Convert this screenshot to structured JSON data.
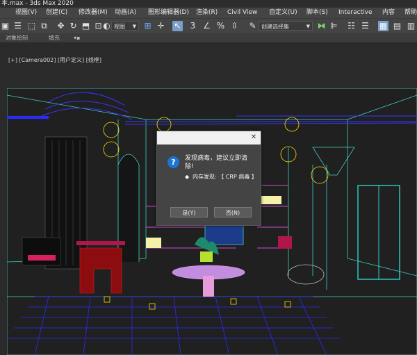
{
  "window": {
    "title": "本.max - 3ds Max 2020"
  },
  "menu": [
    "视图(V)",
    "创建(C)",
    "修改器(M)",
    "动画(A)",
    "图形编辑器(D)",
    "渲染(R)",
    "Civil View",
    "自定义(U)",
    "脚本(S)",
    "Interactive",
    "内容",
    "帮助"
  ],
  "toolbar": {
    "view_dropdown": "视图",
    "selection_set_dropdown": "创建选择集"
  },
  "ribbon": {
    "tab1": "对象绘制",
    "tab2": "填充"
  },
  "viewport": {
    "label": "[+] [Camera002] [用户定义] [线框]"
  },
  "dialog": {
    "message": "发现病毒，建议立即清除!",
    "detail": "内存发现: 【 CRP 病毒 】",
    "yes_label": "是(Y)",
    "no_label": "否(N)",
    "close_glyph": "✕",
    "question_glyph": "?",
    "bullet_glyph": "◆"
  },
  "colors": {
    "accent": "#1c74d4",
    "toolbar_bg": "#444444"
  }
}
